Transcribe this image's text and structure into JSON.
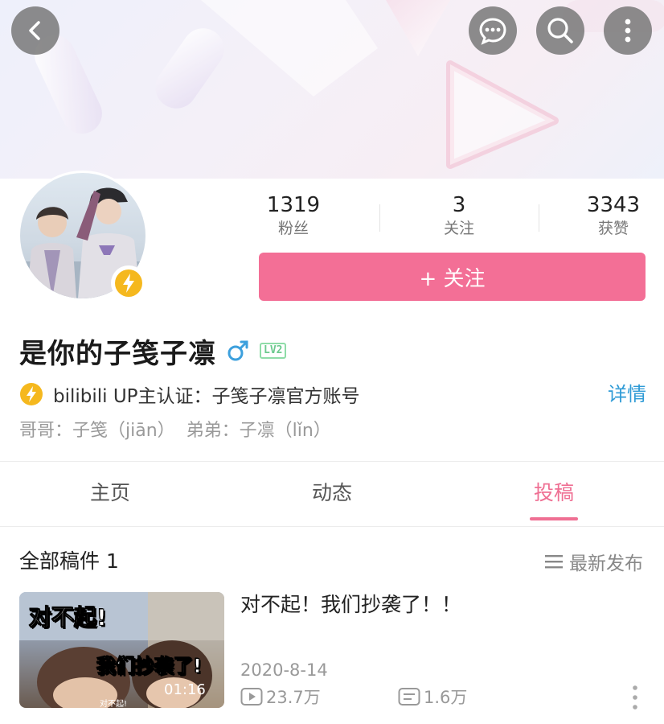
{
  "header": {
    "back_icon": "chevron-left-icon",
    "message_icon": "chat-bubble-icon",
    "search_icon": "search-icon",
    "more_icon": "vertical-dots-icon"
  },
  "profile": {
    "stats": [
      {
        "value": "1319",
        "label": "粉丝"
      },
      {
        "value": "3",
        "label": "关注"
      },
      {
        "value": "3343",
        "label": "获赞"
      }
    ],
    "follow_label": "+ 关注",
    "name": "是你的子笺子凛",
    "gender_icon": "male-symbol-icon",
    "level": "LV2",
    "verify_text": "bilibili  UP主认证：子笺子凛官方账号",
    "detail_label": "详情",
    "bio": "哥哥：子笺（jiān）  弟弟：子凛（lǐn）"
  },
  "tabs": [
    {
      "label": "主页",
      "active": false
    },
    {
      "label": "动态",
      "active": false
    },
    {
      "label": "投稿",
      "active": true
    }
  ],
  "uploads": {
    "title": "全部稿件 1",
    "sort_label": "最新发布",
    "videos": [
      {
        "title": "对不起！我们抄袭了！！",
        "thumb_caption_1": "对不起!",
        "thumb_caption_2": "我们抄袭了!",
        "thumb_subtitle": "对不起!",
        "duration": "01:16",
        "date": "2020-8-14",
        "views": "23.7万",
        "danmaku": "1.6万"
      }
    ]
  },
  "colors": {
    "accent_pink": "#f36f96",
    "link_blue": "#2f9bd6",
    "verify_yellow": "#f5b81e",
    "level_green": "#6cc98e"
  }
}
